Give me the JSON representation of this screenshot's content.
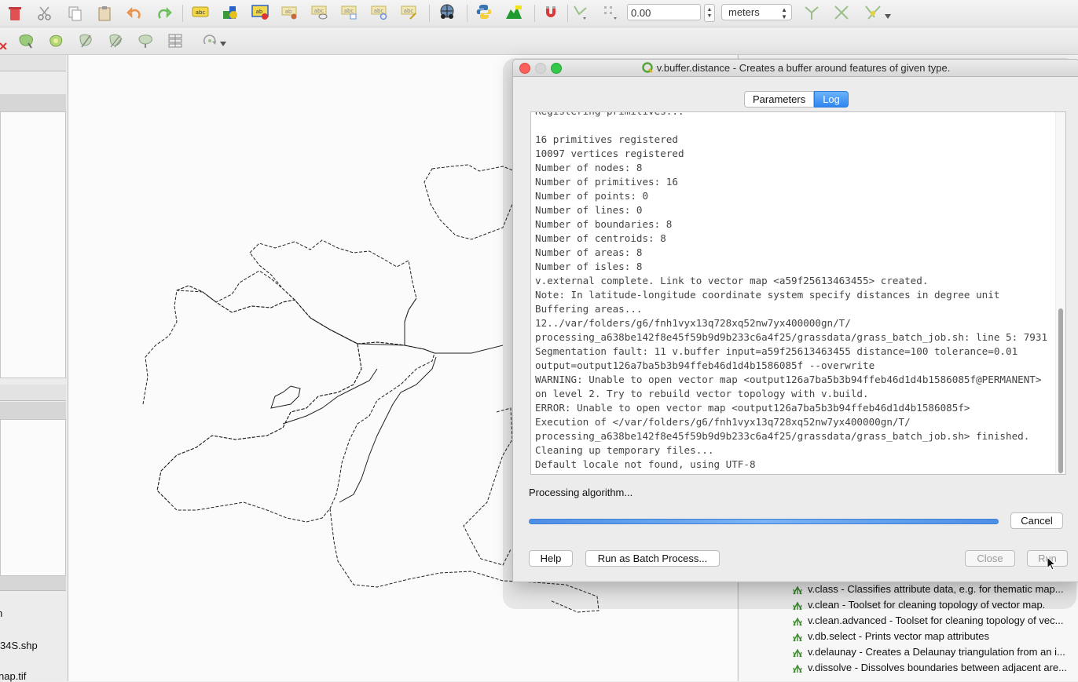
{
  "toolbar": {
    "snap_tolerance_value": "0.00",
    "units_select": "meters"
  },
  "left_panel": {
    "items": [
      "h",
      "34S.shp",
      "nap.tif"
    ]
  },
  "dialog": {
    "title": "v.buffer.distance - Creates a buffer around features of given type.",
    "tabs": [
      {
        "label": "Parameters",
        "active": false
      },
      {
        "label": "Log",
        "active": true
      }
    ],
    "log_lines": [
      "Registering primitives...",
      "",
      "16 primitives registered",
      "10097 vertices registered",
      "Number of nodes: 8",
      "Number of primitives: 16",
      "Number of points: 0",
      "Number of lines: 0",
      "Number of boundaries: 8",
      "Number of centroids: 8",
      "Number of areas: 8",
      "Number of isles: 8",
      "v.external complete. Link to vector map <a59f25613463455> created.",
      "Note: In latitude-longitude coordinate system specify distances in degree unit",
      "Buffering areas...",
      "12../var/folders/g6/fnh1vyx13q728xq52nw7yx400000gn/T/",
      "processing_a638be142f8e45f59b9d9b233c6a4f25/grassdata/grass_batch_job.sh: line 5: 7931",
      "Segmentation fault: 11 v.buffer input=a59f25613463455 distance=100 tolerance=0.01",
      "output=output126a7ba5b3b94ffeb46d1d4b1586085f --overwrite",
      "WARNING: Unable to open vector map <output126a7ba5b3b94ffeb46d1d4b1586085f@PERMANENT>",
      "on level 2. Try to rebuild vector topology with v.build.",
      "ERROR: Unable to open vector map <output126a7ba5b3b94ffeb46d1d4b1586085f>",
      "Execution of </var/folders/g6/fnh1vyx13q728xq52nw7yx400000gn/T/",
      "processing_a638be142f8e45f59b9d9b233c6a4f25/grassdata/grass_batch_job.sh> finished.",
      "Cleaning up temporary files...",
      "Default locale not found, using UTF-8"
    ],
    "status_text": "Processing algorithm...",
    "progress_fraction": 1.0,
    "cancel_label": "Cancel",
    "help_label": "Help",
    "batch_label": "Run as Batch Process...",
    "close_label": "Close",
    "run_label": "Run"
  },
  "algorithms": [
    "v.class - Classifies attribute data, e.g. for thematic map...",
    "v.clean - Toolset for cleaning topology of vector map.",
    "v.clean.advanced - Toolset for cleaning topology of vec...",
    "v.db.select - Prints vector map attributes",
    "v.delaunay - Creates a Delaunay triangulation from an i...",
    "v.dissolve - Dissolves boundaries between adjacent are..."
  ],
  "colors": {
    "accent": "#2f86f0",
    "close_dot": "#fc605b",
    "min_dot": "#d0d0d0",
    "max_dot": "#34c84a"
  }
}
